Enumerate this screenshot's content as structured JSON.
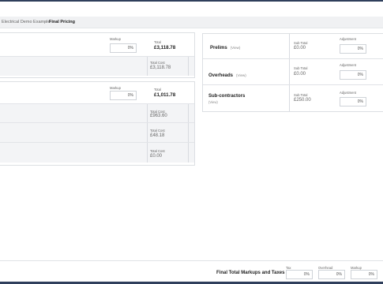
{
  "breadcrumb": {
    "project": "Electrical Demo Example",
    "separator": "›",
    "current": "Final Pricing"
  },
  "left_panels": [
    {
      "markup_label": "Markup",
      "markup_value": "0%",
      "total_label": "Total",
      "total_value": "£3,118.78",
      "rows": [
        {
          "label": "Total Cost",
          "value": "£3,118.78"
        }
      ]
    },
    {
      "markup_label": "Markup",
      "markup_value": "0%",
      "total_label": "Total",
      "total_value": "£1,011.78",
      "rows": [
        {
          "label": "Total Cost",
          "value": "£963.60"
        },
        {
          "label": "Total Cost",
          "value": "£48.18"
        },
        {
          "label": "Total Cost",
          "value": "£0.00"
        }
      ]
    }
  ],
  "right_sections": [
    {
      "title": "Prelims",
      "link": "(View)",
      "subtotal_label": "Sub Total",
      "subtotal_value": "£0.00",
      "adjustment_label": "Adjustment",
      "adjustment_value": "0%"
    },
    {
      "title": "Overheads",
      "link": "(View)",
      "subtotal_label": "Sub Total",
      "subtotal_value": "£0.00",
      "adjustment_label": "Adjustment",
      "adjustment_value": "0%"
    },
    {
      "title": "Sub-contractors",
      "link": "(View)",
      "subtotal_label": "Sub Total",
      "subtotal_value": "£250.00",
      "adjustment_label": "Adjustment",
      "adjustment_value": "0%"
    }
  ],
  "footer": {
    "title": "Final Total Markups and Taxes",
    "fields": [
      {
        "label": "Tax",
        "value": "0%"
      },
      {
        "label": "Overhead",
        "value": "0%"
      },
      {
        "label": "Markup",
        "value": "0%"
      }
    ]
  },
  "colors": {
    "nav": "#2f3f5c",
    "panel_border": "#dcdfe3",
    "row_bg": "#f3f4f6"
  }
}
